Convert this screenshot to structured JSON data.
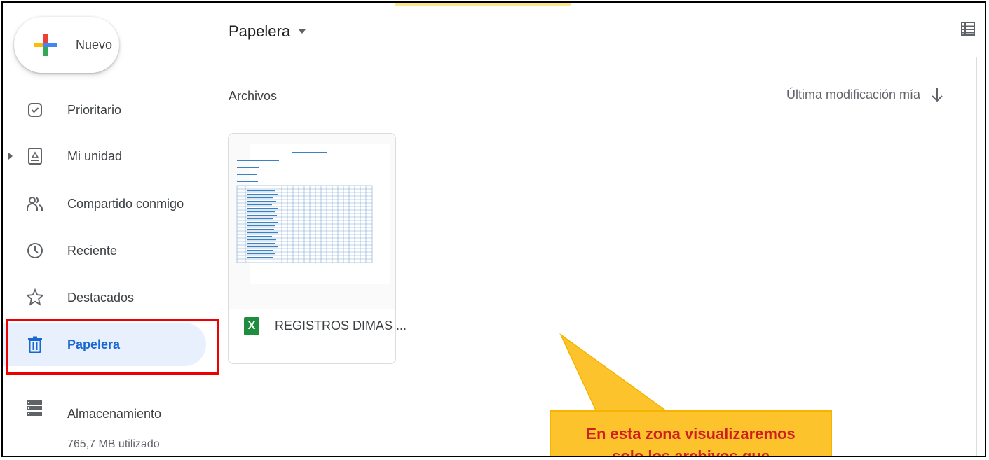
{
  "sidebar": {
    "new_label": "Nuevo",
    "items": [
      {
        "label": "Prioritario",
        "icon": "checkbox-icon"
      },
      {
        "label": "Mi unidad",
        "icon": "drive-icon"
      },
      {
        "label": "Compartido conmigo",
        "icon": "people-icon"
      },
      {
        "label": "Reciente",
        "icon": "clock-icon"
      },
      {
        "label": "Destacados",
        "icon": "star-icon"
      },
      {
        "label": "Papelera",
        "icon": "trash-icon",
        "active": true
      }
    ],
    "storage_label": "Almacenamiento",
    "storage_used": "765,7 MB utilizado"
  },
  "header": {
    "title": "Papelera"
  },
  "main": {
    "section_label": "Archivos",
    "sort_label": "Última modificación mía",
    "files": [
      {
        "name": "REGISTROS DIMAS ...",
        "type_badge": "X"
      }
    ]
  },
  "callout": {
    "line1": "En esta zona visualizaremos",
    "line2": "solo los archivos que"
  },
  "colors": {
    "accent": "#1967d2",
    "active_bg": "#e8f0fe",
    "highlight_border": "#ee0000",
    "callout_bg": "#fdc32d",
    "callout_text": "#d01f1f",
    "excel_green": "#1e8e3e"
  }
}
